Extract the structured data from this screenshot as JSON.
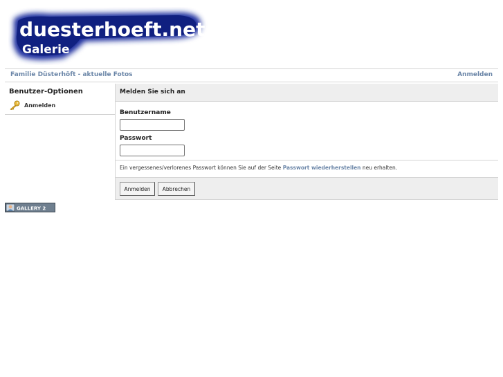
{
  "header": {
    "logo_title": "duesterhoeft.net",
    "logo_subtitle": "Galerie"
  },
  "breadcrumb": {
    "home_label": "Familie Düsterhöft - aktuelle Fotos",
    "login_link": "Anmelden"
  },
  "sidebar": {
    "title": "Benutzer-Optionen",
    "items": [
      {
        "label": "Anmelden",
        "icon": "key-icon"
      }
    ]
  },
  "login_form": {
    "title": "Melden Sie sich an",
    "username_label": "Benutzername",
    "username_value": "",
    "password_label": "Passwort",
    "password_value": "",
    "recovery_text_before": "Ein vergessenes/verlorenes Passwort können Sie auf der Seite",
    "recovery_link": "Passwort wiederherstellen",
    "recovery_text_after": "neu erhalten.",
    "submit_label": "Anmelden",
    "cancel_label": "Abbrechen"
  },
  "footer": {
    "badge_text": "GALLERY 2"
  },
  "colors": {
    "link": "#6b86a8",
    "logo_blue": "#1a2f9e",
    "panel_bg": "#eeeeee",
    "border": "#d3d3d3"
  }
}
